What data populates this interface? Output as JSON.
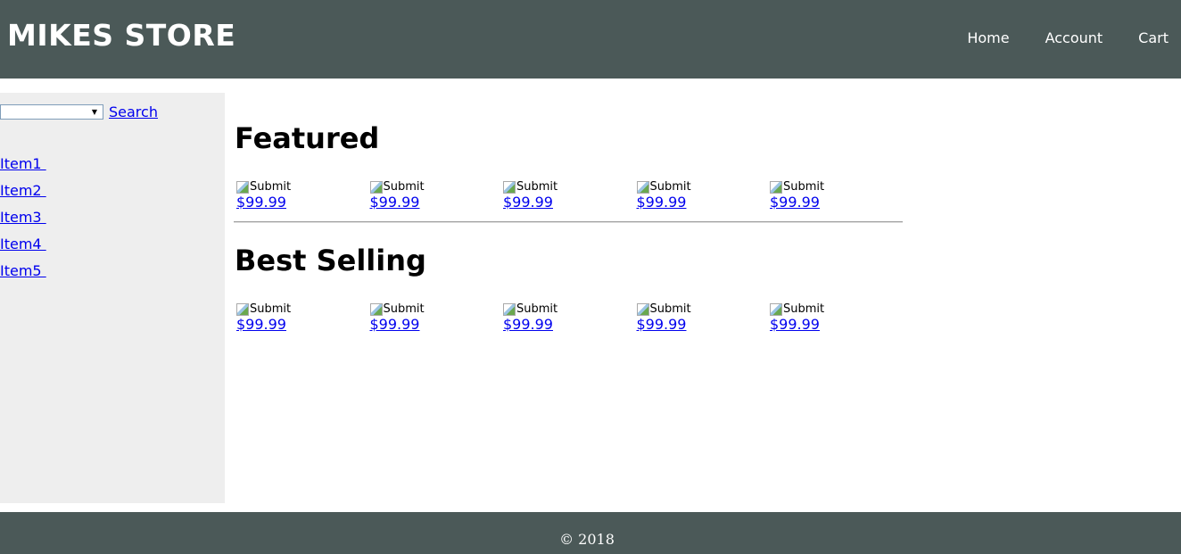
{
  "header": {
    "title": "MIKES STORE",
    "nav": [
      "Home",
      "Account",
      "Cart"
    ]
  },
  "sidebar": {
    "search_label": "Search",
    "select_value": "",
    "items": [
      "Item1 ",
      "Item2 ",
      "Item3 ",
      "Item4 ",
      "Item5 "
    ]
  },
  "featured": {
    "heading": "Featured",
    "products": [
      {
        "image_alt": "Submit",
        "price": "$99.99"
      },
      {
        "image_alt": "Submit",
        "price": "$99.99"
      },
      {
        "image_alt": "Submit",
        "price": "$99.99"
      },
      {
        "image_alt": "Submit",
        "price": "$99.99"
      },
      {
        "image_alt": "Submit",
        "price": "$99.99"
      }
    ]
  },
  "best_selling": {
    "heading": "Best Selling",
    "products": [
      {
        "image_alt": "Submit",
        "price": "$99.99"
      },
      {
        "image_alt": "Submit",
        "price": "$99.99"
      },
      {
        "image_alt": "Submit",
        "price": "$99.99"
      },
      {
        "image_alt": "Submit",
        "price": "$99.99"
      },
      {
        "image_alt": "Submit",
        "price": "$99.99"
      }
    ]
  },
  "footer": {
    "copyright": "© 2018"
  },
  "colors": {
    "header_bg": "#4b5958",
    "sidebar_bg": "#eeeeee",
    "link": "#0000ee"
  }
}
